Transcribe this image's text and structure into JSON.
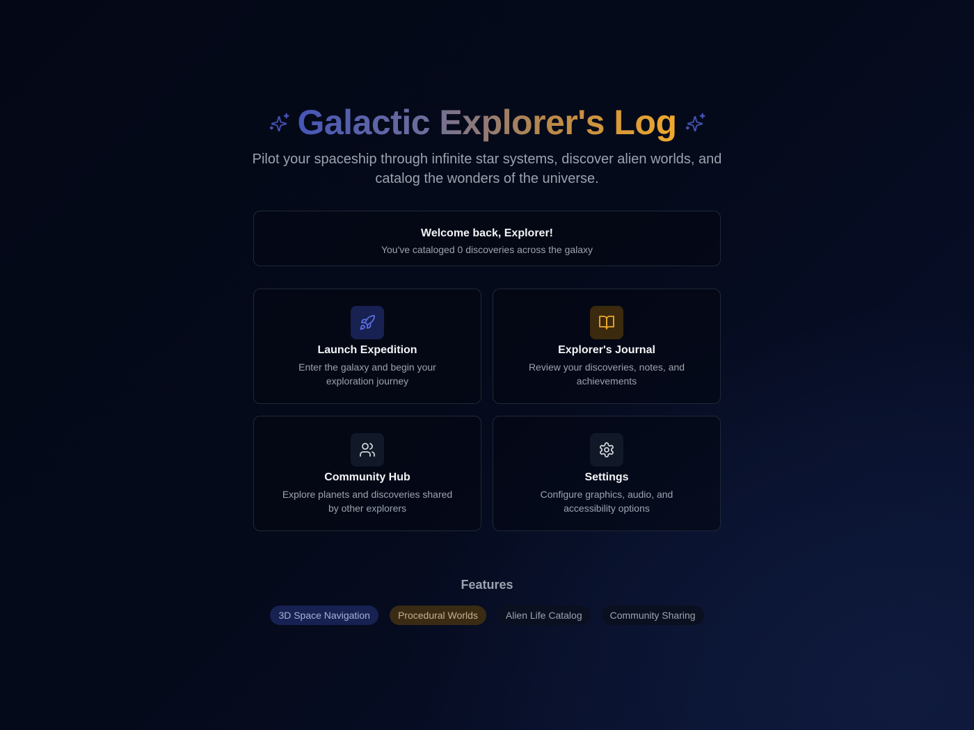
{
  "header": {
    "title": "Galactic Explorer's Log",
    "subtitle": "Pilot your spaceship through infinite star systems, discover alien worlds, and catalog the wonders of the universe."
  },
  "welcome": {
    "title": "Welcome back, Explorer!",
    "subtitle": "You've cataloged 0 discoveries across the galaxy"
  },
  "cards": [
    {
      "title": "Launch Expedition",
      "description": "Enter the galaxy and begin your exploration journey",
      "icon": "rocket-icon",
      "accent": "#5b6ee1"
    },
    {
      "title": "Explorer's Journal",
      "description": "Review your discoveries, notes, and achievements",
      "icon": "book-icon",
      "accent": "#f0a92c"
    },
    {
      "title": "Community Hub",
      "description": "Explore planets and discoveries shared by other explorers",
      "icon": "users-icon",
      "accent": "#d1d5db"
    },
    {
      "title": "Settings",
      "description": "Configure graphics, audio, and accessibility options",
      "icon": "gear-icon",
      "accent": "#d1d5db"
    }
  ],
  "features": {
    "title": "Features",
    "items": [
      "3D Space Navigation",
      "Procedural Worlds",
      "Alien Life Catalog",
      "Community Sharing"
    ]
  },
  "colors": {
    "background": "#050a1b",
    "primary": "#4655b8",
    "accent": "#f0a92c",
    "border": "#1f2937"
  }
}
